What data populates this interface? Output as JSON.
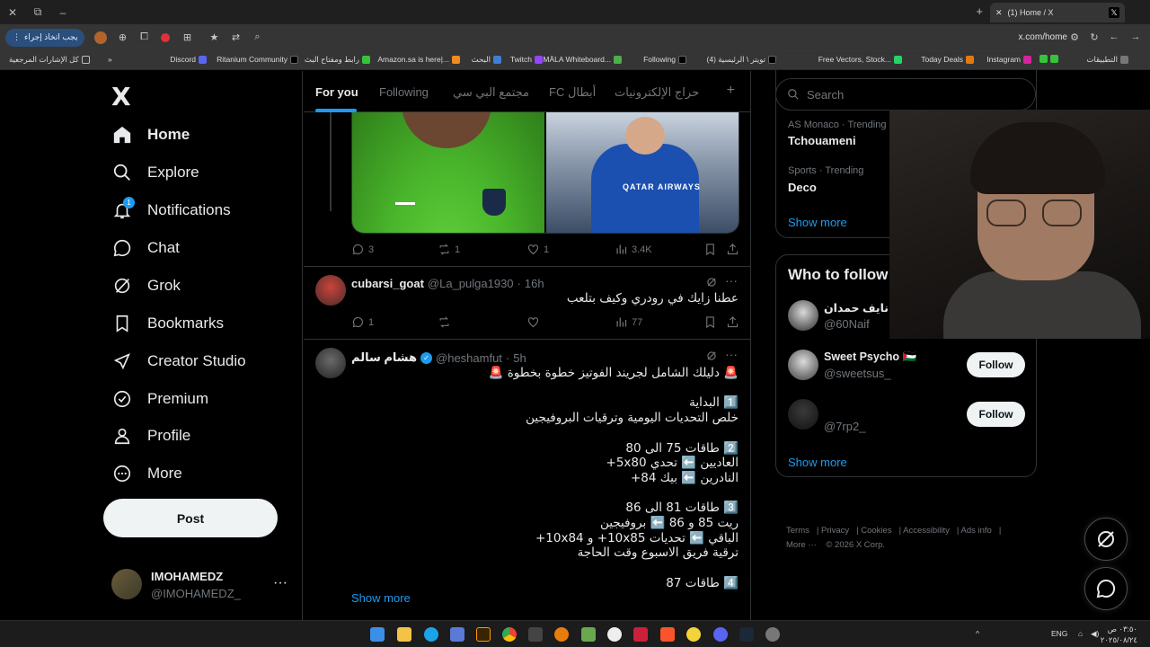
{
  "browser": {
    "tab_title": "(1) Home / X",
    "url": "x.com/home",
    "action_button": "يجب اتخاذ إجراء",
    "bookmarks": [
      "التطبيقات",
      "Instagram",
      "Today Deals",
      "Free Vectors, Stock...",
      "تويتر \\ الرئيسية (4)",
      "Following",
      "MÄLA Whiteboard...",
      "Twitch",
      "البحث",
      "Amazon.sa is here|...",
      "رابط ومفتاح البث",
      "Ritanium Community",
      "Discord",
      "كل الإشارات المرجعية"
    ]
  },
  "nav": {
    "brand": "X",
    "items": [
      "Home",
      "Explore",
      "Notifications",
      "Chat",
      "Grok",
      "Bookmarks",
      "Creator Studio",
      "Premium",
      "Profile",
      "More"
    ],
    "notifications_badge": "1",
    "post_label": "Post",
    "account": {
      "name": "IMOHAMEDZ",
      "handle": "@IMOHAMEDZ_"
    }
  },
  "feed": {
    "tabs": [
      "For you",
      "Following",
      "مجتمع البي سي",
      "FC أبطال",
      "حراج الإلكترونيات"
    ],
    "tweet1_actions": {
      "replies": "3",
      "reposts": "1",
      "likes": "1",
      "views": "3.4K"
    },
    "tweet2": {
      "name": "cubarsi_goat",
      "handle": "@La_pulga1930",
      "time": "16h",
      "text": "عطنا زايك في رودري وكيف بتلعب",
      "replies": "1",
      "views": "77"
    },
    "tweet3": {
      "name": "هشام سالم",
      "handle": "@heshamfut",
      "time": "5h",
      "text": "🚨 دليلك الشامل لجريند الفوتيز خطوة بخطوة 🚨\n\n1️⃣ البداية\nخلص التحديات اليومية وترقيات البروفيجين\n\n2️⃣ طاقات 75 الى 80\nالعاديين ⬅️ تحدي 5x80+\nالنادرين ⬅️ بيك 84+\n\n3️⃣ طاقات 81 الى 86\nريت 85 و 86 ⬅️ بروفيجين\nالباقي ⬅️ تحديات 10x85+ و 10x84+\nترقية فريق الاسبوع وقت الحاجة\n\n4️⃣ طاقات 87",
      "show_more": "Show more"
    },
    "image_right_text": "QATAR AIRWAYS"
  },
  "right": {
    "search_placeholder": "Search",
    "trends": [
      {
        "meta": "AS Monaco · Trending",
        "name": "Tchouameni"
      },
      {
        "meta": "Sports · Trending",
        "name": "Deco"
      }
    ],
    "trends_show_more": "Show more",
    "who_to_follow": "Who to follow",
    "suggestions": [
      {
        "name": "نايف حمدان",
        "handle": "@60Naif"
      },
      {
        "name": "Sweet Psycho 🇵🇸",
        "handle": "@sweetsus_",
        "button": "Follow"
      },
      {
        "name": "",
        "handle": "@7rp2_",
        "button": "Follow"
      }
    ],
    "follow_show_more": "Show more",
    "footer": [
      "Terms",
      "Privacy",
      "Cookies",
      "Accessibility",
      "Ads info",
      "More ···",
      "© 2026 X Corp."
    ]
  },
  "taskbar": {
    "lang": "ENG",
    "time": "٠٣:٥٠ ص",
    "date": "٢٠٢٥/٠٨/٢٤"
  },
  "colors": {
    "accent": "#1d9bf0",
    "background": "#000000",
    "border": "#2f3336",
    "muted": "#71767b"
  }
}
